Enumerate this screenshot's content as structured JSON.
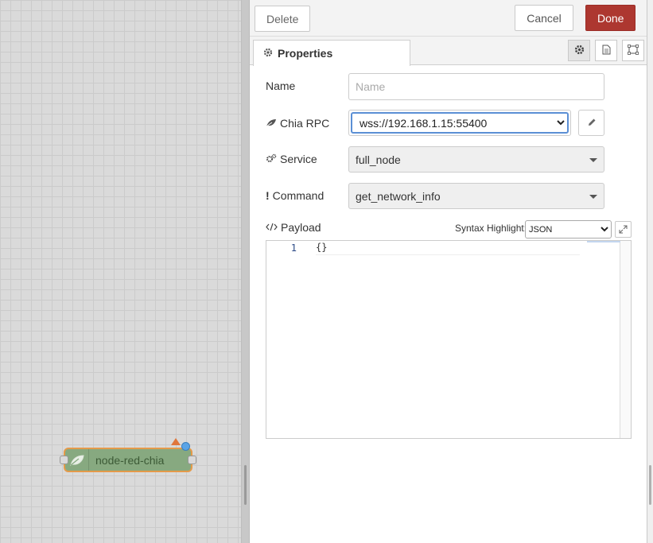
{
  "workspace": {
    "node": {
      "label": "node-red-chia"
    }
  },
  "toolbar": {
    "delete_label": "Delete",
    "cancel_label": "Cancel",
    "done_label": "Done"
  },
  "tabs": {
    "properties_label": "Properties"
  },
  "form": {
    "name": {
      "label": "Name",
      "value": "",
      "placeholder": "Name"
    },
    "chia_rpc": {
      "label": "Chia RPC",
      "selected": "wss://192.168.1.15:55400"
    },
    "service": {
      "label": "Service",
      "selected": "full_node"
    },
    "command": {
      "label": "Command",
      "selected": "get_network_info"
    },
    "payload": {
      "label": "Payload",
      "syntax_label": "Syntax Highlight:",
      "syntax_selected": "JSON",
      "line_number": "1",
      "code": "{}"
    }
  },
  "colors": {
    "done_button": "#ad3730",
    "node_fill": "#87a980",
    "node_border": "#e49a4a",
    "focus_border": "#5b8fd5"
  }
}
